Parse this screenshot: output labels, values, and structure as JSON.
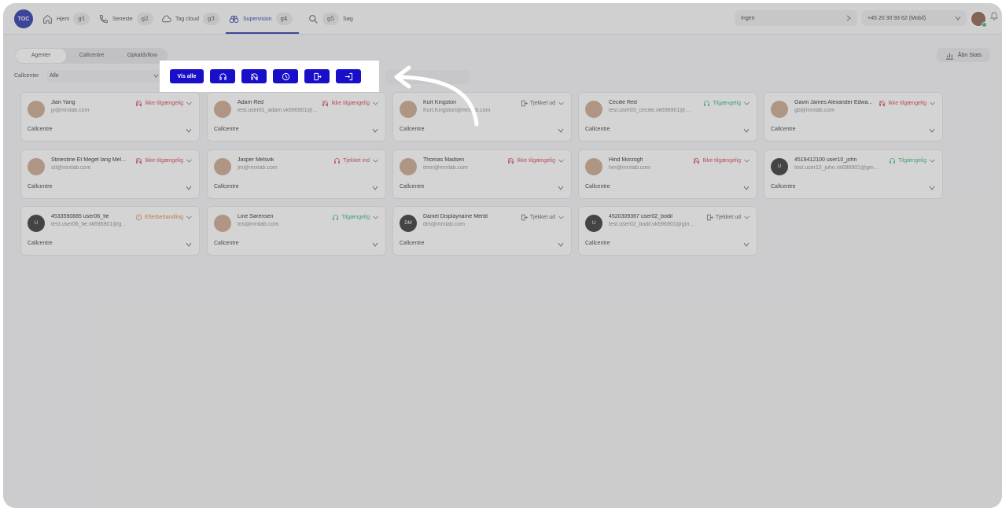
{
  "nav": {
    "logo": "TOC",
    "items": [
      {
        "label": "Hjem",
        "badge": "g1",
        "icon": "home-icon"
      },
      {
        "label": "Seneste",
        "badge": "g2",
        "icon": "phone-icon"
      },
      {
        "label": "Tag cloud",
        "badge": "g3",
        "icon": "cloud-icon"
      },
      {
        "label": "Supervision",
        "badge": "g4",
        "icon": "binoculars-icon"
      },
      {
        "label": "Søg",
        "badge": "g5",
        "icon": "search-icon"
      }
    ],
    "select_ingen": "Ingen",
    "select_number": "+45 20 30 93 62 (Mobil)",
    "accent": "#1e2ea8"
  },
  "tabs": [
    "Agenter",
    "Callcentre",
    "Opkaldsflow"
  ],
  "stats_button": "Åbn Stats",
  "filter": {
    "label": "Callcenter",
    "value": "Alle"
  },
  "filter_buttons": {
    "show_all": "Vis alle",
    "icons": [
      "headset-icon",
      "headset-off-icon",
      "clock-icon",
      "checkout-icon",
      "checkin-icon"
    ]
  },
  "agents": [
    {
      "name": "Jian Yang",
      "email": "jy@mrxlab.com",
      "status": "Ikke tilgængelig",
      "status_kind": "unavailable",
      "callcentre": "Callcentre",
      "initials": ""
    },
    {
      "name": "Adam Red",
      "email": "test.user01_adam.vk696901@...",
      "status": "Ikke tilgængelig",
      "status_kind": "unavailable",
      "callcentre": "Callcentre",
      "initials": ""
    },
    {
      "name": "Kurt Kingston",
      "email": "Kurt.Kingston@mrxlab.com",
      "status": "Tjekket ud",
      "status_kind": "checkedout",
      "callcentre": "Callcentre",
      "initials": ""
    },
    {
      "name": "Cecilie Red",
      "email": "test.user03_cecilie.vk696901@mr...",
      "status": "Tilgængelig",
      "status_kind": "available",
      "callcentre": "Callcentre",
      "initials": ""
    },
    {
      "name": "Gavin James Alexander Edwa...",
      "email": "gb@mrxlab.com",
      "status": "Ikke tilgængelig",
      "status_kind": "unavailable",
      "callcentre": "Callcentre",
      "initials": ""
    },
    {
      "name": "Stinestine Et Meget lang Mel...",
      "email": "stl@mrxlab.com",
      "status": "Ikke tilgængelig",
      "status_kind": "unavailable",
      "callcentre": "Callcentre",
      "initials": ""
    },
    {
      "name": "Jasper Melsvik",
      "email": "jm@mrxlab.com",
      "status": "Tjekket ind",
      "status_kind": "checkedin",
      "callcentre": "Callcentre",
      "initials": ""
    },
    {
      "name": "Thomas Madsen",
      "email": "tmm@mrxlab.com",
      "status": "Ikke tilgængelig",
      "status_kind": "unavailable",
      "callcentre": "Callcentre",
      "initials": ""
    },
    {
      "name": "Hind Morzogh",
      "email": "hm@mrxlab.com",
      "status": "Ikke tilgængelig",
      "status_kind": "unavailable",
      "callcentre": "Callcentre",
      "initials": ""
    },
    {
      "name": "4519412100 user10_john",
      "email": "test.user10_john.vk696901@gmai...",
      "status": "Tilgængelig",
      "status_kind": "available",
      "callcentre": "Callcentre",
      "initials": "U"
    },
    {
      "name": "4533590885 user06_fie",
      "email": "test.user06_fie.vk696901@g...",
      "status": "Efterbehandling",
      "status_kind": "wrapup",
      "callcentre": "Callcentre",
      "initials": "U"
    },
    {
      "name": "Line Sørensen",
      "email": "los@mrxlab.com",
      "status": "Tilgængelig",
      "status_kind": "available",
      "callcentre": "Callcentre",
      "initials": ""
    },
    {
      "name": "Daniel Displayname Merbt",
      "email": "dm@mrxlab.com",
      "status": "Tjekket ud",
      "status_kind": "checkedout",
      "callcentre": "Callcentre",
      "initials": "DM"
    },
    {
      "name": "4520309367 user02_bodil",
      "email": "test.user02_bodil.vk696901@gmail...",
      "status": "Tjekket ud",
      "status_kind": "checkedout",
      "callcentre": "Callcentre",
      "initials": "U"
    }
  ]
}
